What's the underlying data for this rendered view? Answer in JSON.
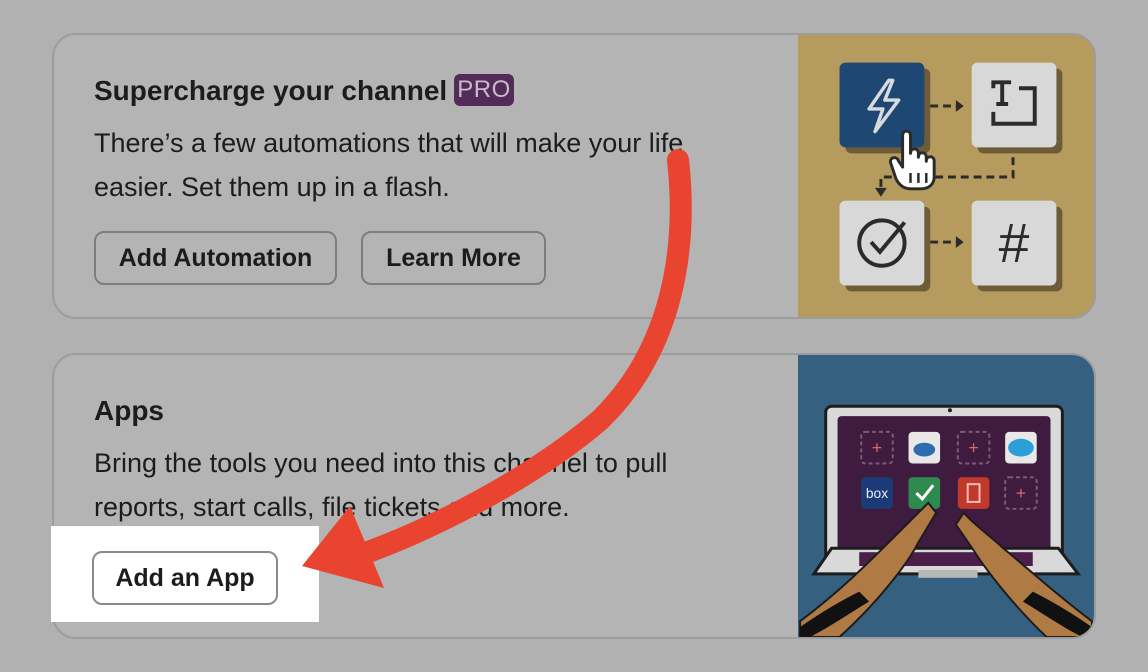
{
  "automations_card": {
    "title": "Supercharge your channel",
    "badge": "PRO",
    "description": "There’s a few automations that will make your life easier. Set them up in a flash.",
    "add_button": "Add Automation",
    "learn_button": "Learn More",
    "illustration": {
      "hash_glyph": "#",
      "icons": [
        "lightning-icon",
        "text-icon",
        "check-circle-icon",
        "hashtag-icon",
        "hand-cursor-icon"
      ]
    }
  },
  "apps_card": {
    "title": "Apps",
    "description": "Bring the tools you need into this channel to pull reports, start calls, file tickets and more.",
    "add_button": "Add an App",
    "illustration": {
      "box_label": "box",
      "tiles": [
        "plus",
        "cloud",
        "plus",
        "salesforce",
        "box",
        "check",
        "document",
        "plus"
      ]
    }
  },
  "annotation": {
    "arrow_color": "#e8442f",
    "highlight_color": "#ffffff"
  }
}
